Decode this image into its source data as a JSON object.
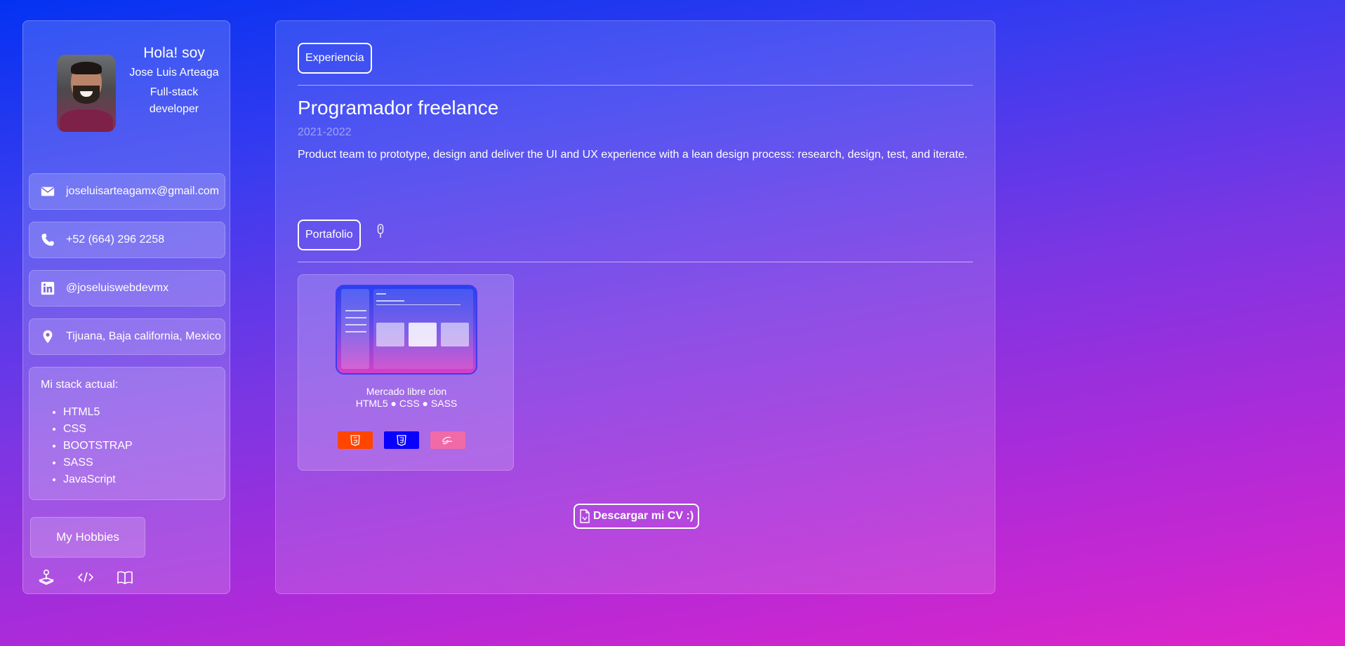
{
  "profile": {
    "greeting": "Hola! soy",
    "name": "Jose Luis Arteaga",
    "role": "Full-stack developer"
  },
  "contacts": [
    {
      "icon": "mail-icon",
      "value": "joseluisarteagamx@gmail.com"
    },
    {
      "icon": "phone-icon",
      "value": "+52 (664) 296 2258"
    },
    {
      "icon": "linkedin-icon",
      "value": "@joseluiswebdevmx"
    },
    {
      "icon": "location-icon",
      "value": "Tijuana, Baja california, Mexico"
    }
  ],
  "stack": {
    "title": "Mi stack actual:",
    "items": [
      "HTML5",
      "CSS",
      "BOOTSTRAP",
      "SASS",
      "JavaScript"
    ]
  },
  "hobbies": {
    "button_label": "My Hobbies",
    "icons": [
      "joystick-icon",
      "code-icon",
      "book-icon"
    ]
  },
  "experience": {
    "tab_label": "Experiencia",
    "job_title": "Programador freelance",
    "dates": "2021-2022",
    "description": "Product team to prototype, design and deliver the UI and UX experience with a lean design process: research, design, test, and iterate."
  },
  "portfolio": {
    "tab_label": "Portafolio",
    "projects": [
      {
        "name": "Mercado libre clon",
        "tech": "HTML5 ● CSS ● SASS",
        "badges": [
          {
            "icon": "html5-icon",
            "color": "#ff4500"
          },
          {
            "icon": "css3-icon",
            "color": "#0a00ff"
          },
          {
            "icon": "sass-icon",
            "color": "#f06aa8"
          }
        ]
      }
    ]
  },
  "cv": {
    "label": "Descargar mi CV :)"
  },
  "colors": {
    "gradient_top": "#0432f2",
    "gradient_bottom": "#df24c9"
  }
}
